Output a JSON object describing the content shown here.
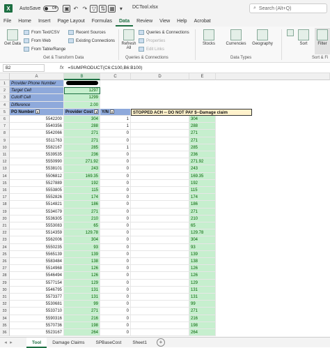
{
  "app": {
    "autosave_label": "AutoSave",
    "autosave_state": "Off",
    "title": "DCTool.xlsx",
    "search_placeholder": "Search (Alt+Q)"
  },
  "tabs": [
    "File",
    "Home",
    "Insert",
    "Page Layout",
    "Formulas",
    "Data",
    "Review",
    "View",
    "Help",
    "Acrobat"
  ],
  "active_tab": "Data",
  "ribbon": {
    "get_data": "Get Data",
    "from_text": "From Text/CSV",
    "from_web": "From Web",
    "from_table": "From Table/Range",
    "recent_sources": "Recent Sources",
    "existing_connections": "Existing Connections",
    "group_get": "Get & Transform Data",
    "refresh_all": "Refresh All",
    "queries_connections": "Queries & Connections",
    "properties": "Properties",
    "edit_links": "Edit Links",
    "group_queries": "Queries & Connections",
    "stocks": "Stocks",
    "currencies": "Currencies",
    "geography": "Geography",
    "group_datatypes": "Data Types",
    "sort": "Sort",
    "filter": "Filter",
    "group_sort": "Sort & Fi"
  },
  "formula_bar": {
    "name_box": "B2",
    "fx": "fx",
    "formula": "=SUMPRODUCT(C6:C100,B6:B100)"
  },
  "columns": [
    "A",
    "B",
    "C",
    "D",
    "E"
  ],
  "info_rows": [
    {
      "label": "Provider Phone Number",
      "value": ""
    },
    {
      "label": "Target Cell",
      "value": "1297"
    },
    {
      "label": "Cutoff Cell",
      "value": "1299"
    },
    {
      "label": "Difference",
      "value": "2.00"
    }
  ],
  "header_row": {
    "a": "PO Number",
    "b": "Provider Cost",
    "c": "Y/N",
    "notice": "STOPPED ACH -- DO NOT PAY $--Damage claim"
  },
  "rows": [
    {
      "po": "5542200",
      "cost": "304",
      "yn": "1",
      "e": "304"
    },
    {
      "po": "5540356",
      "cost": "288",
      "yn": "1",
      "e": "288"
    },
    {
      "po": "5542066",
      "cost": "271",
      "yn": "0",
      "e": "271"
    },
    {
      "po": "5511763",
      "cost": "271",
      "yn": "0",
      "e": "271"
    },
    {
      "po": "5582167",
      "cost": "285",
      "yn": "1",
      "e": "285"
    },
    {
      "po": "5539535",
      "cost": "236",
      "yn": "0",
      "e": "236"
    },
    {
      "po": "5550990",
      "cost": "271.92",
      "yn": "0",
      "e": "271.92"
    },
    {
      "po": "5538101",
      "cost": "243",
      "yn": "0",
      "e": "243"
    },
    {
      "po": "5506812",
      "cost": "169.35",
      "yn": "0",
      "e": "169.35"
    },
    {
      "po": "5527889",
      "cost": "192",
      "yn": "0",
      "e": "192"
    },
    {
      "po": "5553805",
      "cost": "115",
      "yn": "0",
      "e": "115"
    },
    {
      "po": "5552826",
      "cost": "174",
      "yn": "0",
      "e": "174"
    },
    {
      "po": "5514821",
      "cost": "186",
      "yn": "0",
      "e": "186"
    },
    {
      "po": "5534079",
      "cost": "271",
      "yn": "0",
      "e": "271"
    },
    {
      "po": "5536305",
      "cost": "210",
      "yn": "0",
      "e": "210"
    },
    {
      "po": "5553083",
      "cost": "65",
      "yn": "0",
      "e": "65"
    },
    {
      "po": "5514359",
      "cost": "129.78",
      "yn": "0",
      "e": "129.78"
    },
    {
      "po": "5562006",
      "cost": "304",
      "yn": "0",
      "e": "304"
    },
    {
      "po": "5550235",
      "cost": "93",
      "yn": "0",
      "e": "93"
    },
    {
      "po": "5565139",
      "cost": "139",
      "yn": "0",
      "e": "139"
    },
    {
      "po": "5583484",
      "cost": "138",
      "yn": "0",
      "e": "138"
    },
    {
      "po": "5514968",
      "cost": "126",
      "yn": "0",
      "e": "126"
    },
    {
      "po": "5546494",
      "cost": "126",
      "yn": "0",
      "e": "126"
    },
    {
      "po": "5577154",
      "cost": "129",
      "yn": "0",
      "e": "129"
    },
    {
      "po": "5546795",
      "cost": "131",
      "yn": "0",
      "e": "131"
    },
    {
      "po": "5573377",
      "cost": "131",
      "yn": "0",
      "e": "131"
    },
    {
      "po": "5530681",
      "cost": "99",
      "yn": "0",
      "e": "99"
    },
    {
      "po": "5533710",
      "cost": "271",
      "yn": "0",
      "e": "271"
    },
    {
      "po": "5590316",
      "cost": "216",
      "yn": "0",
      "e": "216"
    },
    {
      "po": "5570736",
      "cost": "198",
      "yn": "0",
      "e": "198"
    },
    {
      "po": "5523167",
      "cost": "264",
      "yn": "0",
      "e": "264"
    }
  ],
  "sheets": [
    "Tool",
    "Damage Claims",
    "SPBaseCost",
    "Sheet1"
  ],
  "active_sheet": "Tool",
  "colors": {
    "accent": "#1d6f42",
    "green_fill": "#c6efce",
    "blue_fill": "#8ea9db",
    "yellow_fill": "#fff2cc"
  }
}
